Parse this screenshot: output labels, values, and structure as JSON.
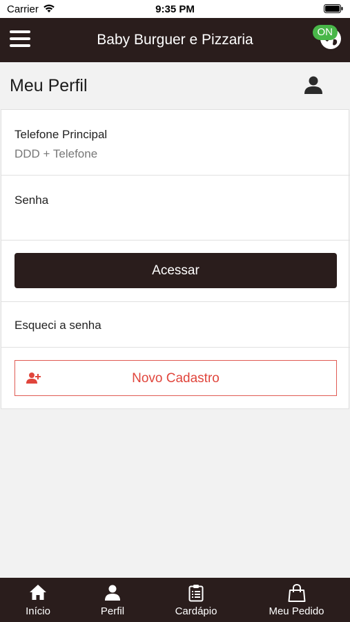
{
  "status_bar": {
    "carrier": "Carrier",
    "time": "9:35 PM"
  },
  "header": {
    "title": "Baby Burguer e Pizzaria",
    "status_badge": "ON"
  },
  "page": {
    "title": "Meu Perfil"
  },
  "form": {
    "phone_label": "Telefone Principal",
    "phone_placeholder": "DDD + Telefone",
    "password_label": "Senha",
    "access_button": "Acessar",
    "forgot_password": "Esqueci a senha",
    "register_button": "Novo Cadastro"
  },
  "tabs": [
    {
      "label": "Início",
      "icon": "home-icon"
    },
    {
      "label": "Perfil",
      "icon": "person-icon"
    },
    {
      "label": "Cardápio",
      "icon": "clipboard-icon"
    },
    {
      "label": "Meu Pedido",
      "icon": "shopping-bag-icon"
    }
  ],
  "colors": {
    "brand_dark": "#2a1d1c",
    "accent_red": "#e0453c",
    "online_green": "#49b749",
    "background": "#f2f2f2"
  }
}
